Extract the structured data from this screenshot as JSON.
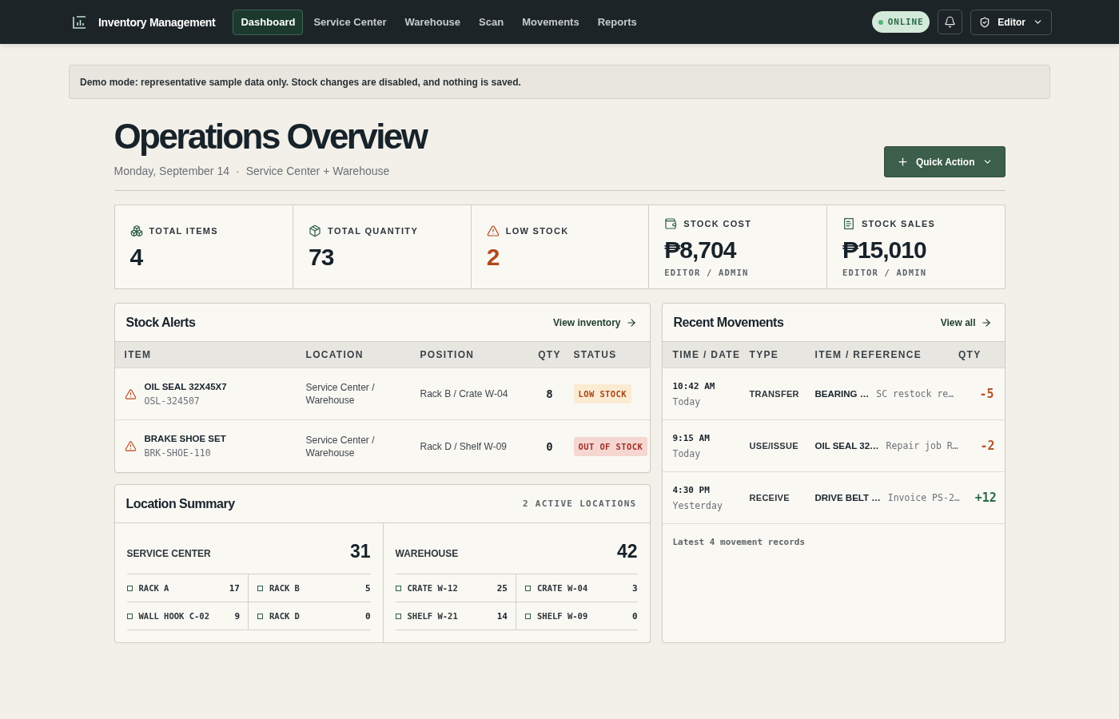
{
  "app": {
    "title": "Inventory Management"
  },
  "nav": {
    "tabs": [
      {
        "label": "Dashboard",
        "selected": true
      },
      {
        "label": "Service Center",
        "selected": false
      },
      {
        "label": "Warehouse",
        "selected": false
      },
      {
        "label": "Scan",
        "selected": false
      },
      {
        "label": "Movements",
        "selected": false
      },
      {
        "label": "Reports",
        "selected": false
      }
    ],
    "status": "ONLINE",
    "user_menu": "Editor"
  },
  "banner": {
    "text": "Demo mode: representative sample data only. Stock changes are disabled, and nothing is saved."
  },
  "page": {
    "title": "Operations Overview",
    "date": "Monday, September 14",
    "separator": "·",
    "scope": "Service Center + Warehouse",
    "quick_action": "Quick Action"
  },
  "stats": [
    {
      "kind": "items",
      "label": "TOTAL ITEMS",
      "value": "4"
    },
    {
      "kind": "quantity",
      "label": "TOTAL QUANTITY",
      "value": "73"
    },
    {
      "kind": "alert",
      "label": "LOW STOCK",
      "value": "2"
    },
    {
      "kind": "cost",
      "label": "STOCK COST",
      "value": "₱8,704",
      "note": "EDITOR / ADMIN"
    },
    {
      "kind": "sales",
      "label": "STOCK SALES",
      "value": "₱15,010",
      "note": "EDITOR / ADMIN"
    }
  ],
  "stock_alerts": {
    "title": "Stock Alerts",
    "link": "View inventory",
    "columns": [
      "ITEM",
      "LOCATION",
      "POSITION",
      "QTY",
      "STATUS"
    ],
    "rows": [
      {
        "name": "OIL SEAL 32X45X7",
        "sku": "OSL-324507",
        "location": "Service Center / Warehouse",
        "position": "Rack B / Crate W-04",
        "qty": "8",
        "status": {
          "kind": "low",
          "label": "LOW STOCK"
        }
      },
      {
        "name": "BRAKE SHOE SET",
        "sku": "BRK-SHOE-110",
        "location": "Service Center / Warehouse",
        "position": "Rack D / Shelf W-09",
        "qty": "0",
        "status": {
          "kind": "out",
          "label": "OUT OF STOCK"
        }
      }
    ]
  },
  "location_summary": {
    "title": "Location Summary",
    "count": "2 ACTIVE LOCATIONS",
    "locations": [
      {
        "name": "SERVICE CENTER",
        "total": "31",
        "slots": [
          {
            "name": "RACK A",
            "qty": "17"
          },
          {
            "name": "RACK B",
            "qty": "5"
          },
          {
            "name": "WALL HOOK C-02",
            "qty": "9"
          },
          {
            "name": "RACK D",
            "qty": "0"
          }
        ]
      },
      {
        "name": "WAREHOUSE",
        "total": "42",
        "slots": [
          {
            "name": "CRATE W-12",
            "qty": "25"
          },
          {
            "name": "CRATE W-04",
            "qty": "3"
          },
          {
            "name": "SHELF W-21",
            "qty": "14"
          },
          {
            "name": "SHELF W-09",
            "qty": "0"
          }
        ]
      }
    ]
  },
  "recent_movements": {
    "title": "Recent Movements",
    "link": "View all",
    "columns": [
      "TIME / DATE",
      "TYPE",
      "ITEM / REFERENCE",
      "QTY"
    ],
    "rows": [
      {
        "kind": "outgoing",
        "time": "10:42 AM",
        "day": "Today",
        "type": "TRANSFER",
        "item": "BEARING …",
        "reference": "SC restock re…",
        "qty": "-5"
      },
      {
        "kind": "outgoing",
        "time": "9:15 AM",
        "day": "Today",
        "type": "USE/ISSUE",
        "item": "OIL SEAL 32…",
        "reference": "Repair job R…",
        "qty": "-2"
      },
      {
        "kind": "incoming",
        "time": "4:30 PM",
        "day": "Yesterday",
        "type": "RECEIVE",
        "item": "DRIVE BELT …",
        "reference": "Invoice PS-2…",
        "qty": "+12"
      }
    ],
    "footer": "Latest 4 movement records"
  }
}
